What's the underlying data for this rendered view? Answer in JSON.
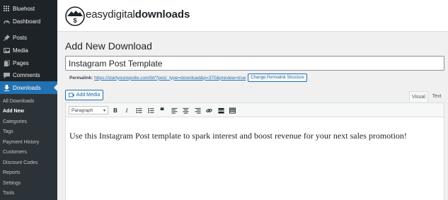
{
  "sidebar": {
    "items": [
      {
        "label": "Bluehost",
        "icon": "bluehost-grid-icon"
      },
      {
        "label": "Dashboard",
        "icon": "dashboard-icon"
      },
      {
        "label": "Posts",
        "icon": "pin-icon"
      },
      {
        "label": "Media",
        "icon": "media-icon"
      },
      {
        "label": "Pages",
        "icon": "page-icon"
      },
      {
        "label": "Comments",
        "icon": "comment-icon"
      },
      {
        "label": "Downloads",
        "icon": "download-icon",
        "active": true
      }
    ],
    "submenu": [
      "All Downloads",
      "Add New",
      "Categories",
      "Tags",
      "Payment History",
      "Customers",
      "Discount Codes",
      "Reports",
      "Settings",
      "Tools"
    ],
    "current_submenu": "Add New",
    "active_color": "#2271b1"
  },
  "brand": {
    "part1": "easy",
    "part2": "digital",
    "part3": "downloads"
  },
  "page": {
    "title": "Add New Download",
    "post_title_value": "Instagram Post Template",
    "permalink_label": "Permalink:",
    "permalink_url": "https://startyourwpsite.com/bt/?post_type=download&p=370&preview=true",
    "change_permalink_label": "Change Permalink Structure",
    "add_media_label": "Add Media"
  },
  "editor": {
    "tab_visual": "Visual",
    "tab_text": "Text",
    "format_value": "Paragraph",
    "toolbar_buttons": [
      "bold-icon",
      "italic-icon",
      "bullet-list-icon",
      "numbered-list-icon",
      "blockquote-icon",
      "align-left-icon",
      "align-center-icon",
      "align-right-icon",
      "link-icon",
      "read-more-icon",
      "toolbar-toggle-icon"
    ],
    "content": "Use this Instagram Post template to spark interest and boost revenue for your next sales promotion!"
  }
}
